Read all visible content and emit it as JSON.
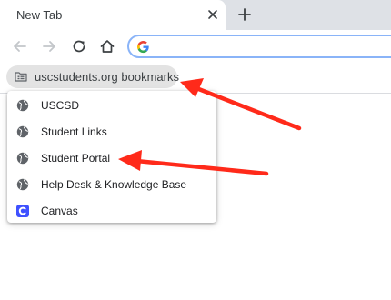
{
  "tab": {
    "title": "New Tab",
    "close_icon": "close-icon",
    "new_tab_icon": "plus-icon"
  },
  "toolbar": {
    "back_icon": "back-arrow-icon",
    "forward_icon": "forward-arrow-icon",
    "reload_icon": "reload-icon",
    "home_icon": "home-icon",
    "omnibox": {
      "value": "",
      "placeholder": "",
      "icon": "google-g-icon"
    }
  },
  "bookmarks_bar": {
    "folder": {
      "label": "uscstudents.org bookmarks",
      "icon": "folder-icon"
    }
  },
  "bookmark_menu": {
    "items": [
      {
        "label": "USCSD",
        "icon": "globe-icon"
      },
      {
        "label": "Student Links",
        "icon": "globe-icon"
      },
      {
        "label": "Student Portal",
        "icon": "globe-icon"
      },
      {
        "label": "Help Desk & Knowledge Base",
        "icon": "globe-icon"
      },
      {
        "label": "Canvas",
        "icon": "canvas-logo-icon"
      }
    ]
  },
  "colors": {
    "annotation_arrow": "#ff2a1a",
    "tab_strip": "#dee1e6",
    "omnibox_focus_ring": "#8ab4f8",
    "canvas_brand": "#3f51ff"
  }
}
